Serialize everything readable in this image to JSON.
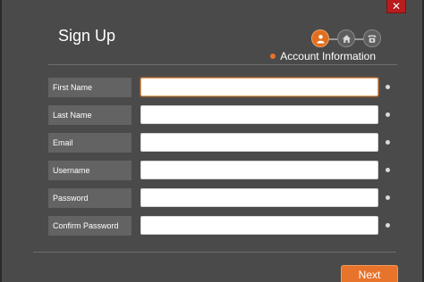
{
  "window": {
    "close_label": "✕"
  },
  "header": {
    "title": "Sign Up",
    "current_step_label": "Account Information",
    "steps": [
      {
        "icon": "user-icon",
        "active": true
      },
      {
        "icon": "home-icon",
        "active": false
      },
      {
        "icon": "phone-icon",
        "active": false
      }
    ]
  },
  "form": {
    "fields": [
      {
        "label": "First Name",
        "value": "",
        "focused": true
      },
      {
        "label": "Last Name",
        "value": ""
      },
      {
        "label": "Email",
        "value": ""
      },
      {
        "label": "Username",
        "value": ""
      },
      {
        "label": "Password",
        "value": ""
      },
      {
        "label": "Confirm Password",
        "value": ""
      }
    ]
  },
  "footer": {
    "next_label": "Next"
  },
  "colors": {
    "accent": "#e8732a",
    "close": "#b91c1c",
    "background": "#4a4a4a"
  }
}
